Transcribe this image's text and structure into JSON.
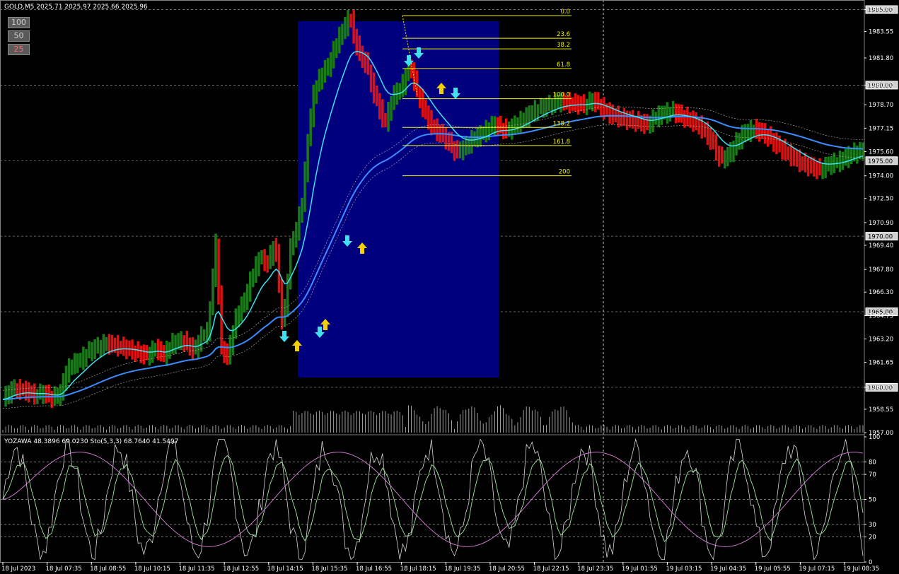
{
  "window": {
    "symbol_header": "GOLD,M5  2025.71 2025.97 2025.66 2025.96"
  },
  "panel_buttons": [
    "100",
    "50",
    "25"
  ],
  "indicator_header": "YOZAWA 48.3896 69.0230  Sto(5,3,3) 68.7640 41.5497",
  "colors": {
    "bull": "#1a7a1a",
    "bear": "#e01010",
    "fast_ma": "#40e0f0",
    "slow_ma": "#3a8cff",
    "box": "#00007f",
    "fib": "#f2f200",
    "arrow_up": "#f5d000",
    "arrow_down": "#40e0f0"
  },
  "chart_data": [
    {
      "type": "candlestick",
      "y_ticks": [
        "1985.00",
        "1983.55",
        "1981.80",
        "1980.00",
        "1978.70",
        "1977.15",
        "1975.60",
        "1974.00",
        "1972.50",
        "1970.90",
        "1969.40",
        "1967.80",
        "1966.30",
        "1964.75",
        "1963.20",
        "1961.65",
        "1960.00",
        "1958.55",
        "1957.00"
      ],
      "price_labels": [
        "1985.00",
        "1980.00",
        "1975.00",
        "1970.00",
        "1965.00",
        "1960.00"
      ],
      "ylim": [
        1957.0,
        1985.4
      ],
      "x_ticks": [
        "18 Jul 2023",
        "18 Jul 07:35",
        "18 Jul 08:55",
        "18 Jul 10:15",
        "18 Jul 11:35",
        "18 Jul 12:55",
        "18 Jul 14:15",
        "18 Jul 15:35",
        "18 Jul 16:55",
        "18 Jul 18:15",
        "18 Jul 19:35",
        "18 Jul 20:55",
        "18 Jul 22:15",
        "18 Jul 23:35",
        "19 Jul 01:55",
        "19 Jul 03:15",
        "19 Jul 04:35",
        "19 Jul 05:55",
        "19 Jul 07:15",
        "19 Jul 08:35"
      ],
      "fib_levels": [
        "0.0",
        "23.6",
        "38.2",
        "61.8",
        "100.0",
        "138.2",
        "161.8",
        "200"
      ],
      "fib_prices": [
        1984.6,
        1983.1,
        1982.4,
        1981.1,
        1979.1,
        1977.2,
        1976.0,
        1974.0
      ],
      "close_path": [
        [
          0,
          1959.2
        ],
        [
          10,
          1959.9
        ],
        [
          22,
          1959.8
        ],
        [
          32,
          1959.5
        ],
        [
          42,
          1959.6
        ],
        [
          52,
          1959.3
        ],
        [
          60,
          1959.6
        ],
        [
          66,
          1961.0
        ],
        [
          74,
          1961.6
        ],
        [
          80,
          1961.7
        ],
        [
          88,
          1962.3
        ],
        [
          96,
          1962.6
        ],
        [
          108,
          1962.9
        ],
        [
          122,
          1962.7
        ],
        [
          136,
          1962.4
        ],
        [
          150,
          1962.1
        ],
        [
          160,
          1962.6
        ],
        [
          168,
          1962.1
        ],
        [
          176,
          1962.9
        ],
        [
          188,
          1963.1
        ],
        [
          200,
          1962.4
        ],
        [
          206,
          1963.3
        ],
        [
          214,
          1963.7
        ],
        [
          222,
          1969.5
        ],
        [
          228,
          1962.6
        ],
        [
          234,
          1962.0
        ],
        [
          244,
          1964.8
        ],
        [
          252,
          1965.7
        ],
        [
          260,
          1967.4
        ],
        [
          268,
          1968.6
        ],
        [
          276,
          1968.2
        ],
        [
          284,
          1969.6
        ],
        [
          292,
          1963.8
        ],
        [
          300,
          1969.2
        ],
        [
          306,
          1970.4
        ],
        [
          312,
          1972.2
        ],
        [
          318,
          1976.3
        ],
        [
          324,
          1979.4
        ],
        [
          332,
          1980.7
        ],
        [
          340,
          1981.3
        ],
        [
          348,
          1982.8
        ],
        [
          356,
          1983.8
        ],
        [
          362,
          1984.6
        ],
        [
          366,
          1983.3
        ],
        [
          372,
          1982.0
        ],
        [
          380,
          1981.3
        ],
        [
          386,
          1979.6
        ],
        [
          392,
          1978.6
        ],
        [
          398,
          1977.4
        ],
        [
          408,
          1979.4
        ],
        [
          416,
          1979.8
        ],
        [
          422,
          1981.2
        ],
        [
          426,
          1981.0
        ],
        [
          432,
          1979.6
        ],
        [
          440,
          1978.2
        ],
        [
          448,
          1977.2
        ],
        [
          456,
          1976.8
        ],
        [
          464,
          1976.3
        ],
        [
          472,
          1975.6
        ],
        [
          480,
          1975.8
        ],
        [
          490,
          1976.4
        ],
        [
          500,
          1976.8
        ],
        [
          512,
          1977.4
        ],
        [
          526,
          1977.0
        ],
        [
          540,
          1977.6
        ],
        [
          554,
          1978.3
        ],
        [
          566,
          1978.6
        ],
        [
          580,
          1978.9
        ],
        [
          594,
          1978.8
        ],
        [
          606,
          1978.7
        ],
        [
          616,
          1979.0
        ],
        [
          626,
          1978.4
        ],
        [
          636,
          1978.0
        ],
        [
          646,
          1977.8
        ],
        [
          660,
          1977.6
        ],
        [
          672,
          1977.4
        ],
        [
          684,
          1978.0
        ],
        [
          698,
          1978.3
        ],
        [
          710,
          1977.9
        ],
        [
          720,
          1977.6
        ],
        [
          730,
          1977.1
        ],
        [
          740,
          1976.2
        ],
        [
          748,
          1975.1
        ],
        [
          756,
          1975.3
        ],
        [
          764,
          1976.1
        ],
        [
          772,
          1976.8
        ],
        [
          784,
          1977.1
        ],
        [
          796,
          1976.7
        ],
        [
          808,
          1976.0
        ],
        [
          820,
          1975.4
        ],
        [
          832,
          1974.9
        ],
        [
          842,
          1974.6
        ],
        [
          852,
          1974.4
        ],
        [
          864,
          1974.8
        ],
        [
          874,
          1975.0
        ],
        [
          884,
          1975.4
        ],
        [
          892,
          1975.6
        ]
      ]
    },
    {
      "type": "line",
      "ylim": [
        0,
        100
      ],
      "y_ticks": [
        "100",
        "80",
        "70",
        "50",
        "30",
        "20",
        "0"
      ]
    }
  ]
}
